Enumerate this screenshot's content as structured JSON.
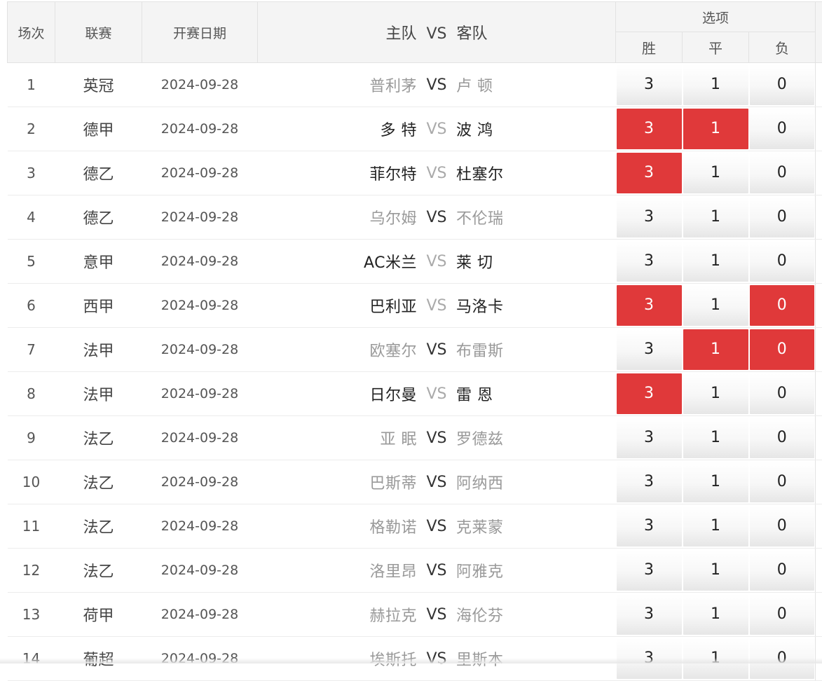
{
  "header": {
    "idx": "场次",
    "league": "联赛",
    "date": "开赛日期",
    "match": "主队  VS  客队",
    "options": "选项",
    "win": "胜",
    "draw": "平",
    "lose": "负"
  },
  "colors": {
    "selected": "#e0393a",
    "header_bg": "#f4f4f4"
  },
  "rows": [
    {
      "idx": "1",
      "league": "英冠",
      "date": "2024-09-28",
      "home": "普利茅",
      "vs": "VS",
      "away": "卢 顿",
      "w": "3",
      "d": "1",
      "l": "0",
      "w_sel": false,
      "d_sel": false,
      "l_sel": false,
      "home_dark": false,
      "away_dark": false,
      "vs_dark": true
    },
    {
      "idx": "2",
      "league": "德甲",
      "date": "2024-09-28",
      "home": "多 特",
      "vs": "VS",
      "away": "波 鸿",
      "w": "3",
      "d": "1",
      "l": "0",
      "w_sel": true,
      "d_sel": true,
      "l_sel": false,
      "home_dark": true,
      "away_dark": true,
      "vs_dark": false
    },
    {
      "idx": "3",
      "league": "德乙",
      "date": "2024-09-28",
      "home": "菲尔特",
      "vs": "VS",
      "away": "杜塞尔",
      "w": "3",
      "d": "1",
      "l": "0",
      "w_sel": true,
      "d_sel": false,
      "l_sel": false,
      "home_dark": true,
      "away_dark": true,
      "vs_dark": false
    },
    {
      "idx": "4",
      "league": "德乙",
      "date": "2024-09-28",
      "home": "乌尔姆",
      "vs": "VS",
      "away": "不伦瑞",
      "w": "3",
      "d": "1",
      "l": "0",
      "w_sel": false,
      "d_sel": false,
      "l_sel": false,
      "home_dark": false,
      "away_dark": false,
      "vs_dark": true
    },
    {
      "idx": "5",
      "league": "意甲",
      "date": "2024-09-28",
      "home": "AC米兰",
      "vs": "VS",
      "away": "莱 切",
      "w": "3",
      "d": "1",
      "l": "0",
      "w_sel": false,
      "d_sel": false,
      "l_sel": false,
      "home_dark": true,
      "away_dark": true,
      "vs_dark": false
    },
    {
      "idx": "6",
      "league": "西甲",
      "date": "2024-09-28",
      "home": "巴利亚",
      "vs": "VS",
      "away": "马洛卡",
      "w": "3",
      "d": "1",
      "l": "0",
      "w_sel": true,
      "d_sel": false,
      "l_sel": true,
      "home_dark": true,
      "away_dark": true,
      "vs_dark": false
    },
    {
      "idx": "7",
      "league": "法甲",
      "date": "2024-09-28",
      "home": "欧塞尔",
      "vs": "VS",
      "away": "布雷斯",
      "w": "3",
      "d": "1",
      "l": "0",
      "w_sel": false,
      "d_sel": true,
      "l_sel": true,
      "home_dark": false,
      "away_dark": false,
      "vs_dark": true
    },
    {
      "idx": "8",
      "league": "法甲",
      "date": "2024-09-28",
      "home": "日尔曼",
      "vs": "VS",
      "away": "雷 恩",
      "w": "3",
      "d": "1",
      "l": "0",
      "w_sel": true,
      "d_sel": false,
      "l_sel": false,
      "home_dark": true,
      "away_dark": true,
      "vs_dark": false
    },
    {
      "idx": "9",
      "league": "法乙",
      "date": "2024-09-28",
      "home": "亚 眠",
      "vs": "VS",
      "away": "罗德兹",
      "w": "3",
      "d": "1",
      "l": "0",
      "w_sel": false,
      "d_sel": false,
      "l_sel": false,
      "home_dark": false,
      "away_dark": false,
      "vs_dark": true
    },
    {
      "idx": "10",
      "league": "法乙",
      "date": "2024-09-28",
      "home": "巴斯蒂",
      "vs": "VS",
      "away": "阿纳西",
      "w": "3",
      "d": "1",
      "l": "0",
      "w_sel": false,
      "d_sel": false,
      "l_sel": false,
      "home_dark": false,
      "away_dark": false,
      "vs_dark": true
    },
    {
      "idx": "11",
      "league": "法乙",
      "date": "2024-09-28",
      "home": "格勒诺",
      "vs": "VS",
      "away": "克莱蒙",
      "w": "3",
      "d": "1",
      "l": "0",
      "w_sel": false,
      "d_sel": false,
      "l_sel": false,
      "home_dark": false,
      "away_dark": false,
      "vs_dark": true
    },
    {
      "idx": "12",
      "league": "法乙",
      "date": "2024-09-28",
      "home": "洛里昂",
      "vs": "VS",
      "away": "阿雅克",
      "w": "3",
      "d": "1",
      "l": "0",
      "w_sel": false,
      "d_sel": false,
      "l_sel": false,
      "home_dark": false,
      "away_dark": false,
      "vs_dark": true
    },
    {
      "idx": "13",
      "league": "荷甲",
      "date": "2024-09-28",
      "home": "赫拉克",
      "vs": "VS",
      "away": "海伦芬",
      "w": "3",
      "d": "1",
      "l": "0",
      "w_sel": false,
      "d_sel": false,
      "l_sel": false,
      "home_dark": false,
      "away_dark": false,
      "vs_dark": true
    },
    {
      "idx": "14",
      "league": "葡超",
      "date": "2024-09-28",
      "home": "埃斯托",
      "vs": "VS",
      "away": "里斯本",
      "w": "3",
      "d": "1",
      "l": "0",
      "w_sel": false,
      "d_sel": false,
      "l_sel": false,
      "home_dark": false,
      "away_dark": false,
      "vs_dark": true
    }
  ]
}
